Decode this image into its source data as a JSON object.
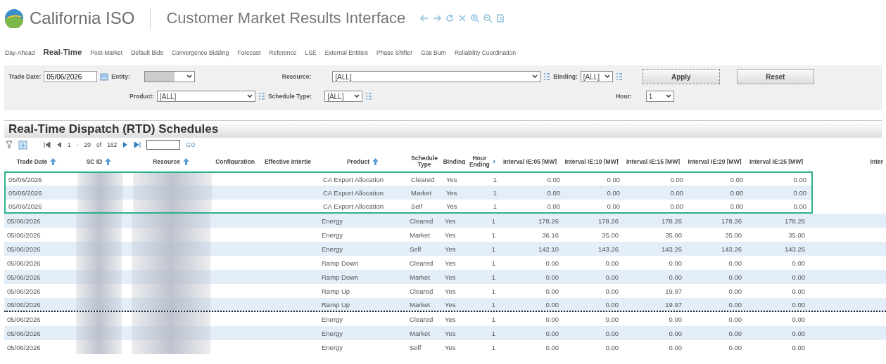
{
  "header": {
    "brand": "California ISO",
    "title": "Customer Market Results Interface"
  },
  "nav": [
    {
      "label": "Day-Ahead",
      "selected": false
    },
    {
      "label": "Real-Time",
      "selected": true
    },
    {
      "label": "Post-Market",
      "selected": false
    },
    {
      "label": "Default Bids",
      "selected": false
    },
    {
      "label": "Convergence Bidding",
      "selected": false
    },
    {
      "label": "Forecast",
      "selected": false
    },
    {
      "label": "Reference",
      "selected": false
    },
    {
      "label": "LSE",
      "selected": false
    },
    {
      "label": "External Entities",
      "selected": false
    },
    {
      "label": "Phase Shifter",
      "selected": false
    },
    {
      "label": "Gas Burn",
      "selected": false
    },
    {
      "label": "Reliability Coordination",
      "selected": false
    }
  ],
  "filters": {
    "trade_date": {
      "label": "Trade Date:",
      "value": "05/06/2026"
    },
    "entity": {
      "label": "Entity:"
    },
    "resource": {
      "label": "Resource:",
      "value": "[ALL]"
    },
    "binding": {
      "label": "Binding:",
      "value": "[ALL]"
    },
    "product": {
      "label": "Product:",
      "value": "[ALL]"
    },
    "schedule_type": {
      "label": "Schedule Type:",
      "value": "[ALL]"
    },
    "hour": {
      "label": "Hour:",
      "value": "1"
    },
    "buttons": [
      "Apply",
      "Reset"
    ]
  },
  "section_title": "Real-Time Dispatch (RTD) Schedules",
  "pager": {
    "from": "1",
    "dash": "-",
    "to": "20",
    "of": "of",
    "total": "162",
    "go": "GO"
  },
  "table": {
    "columns": [
      {
        "label": "Trade Date",
        "sortable": true
      },
      {
        "label": "SC ID",
        "sortable": true
      },
      {
        "label": "Resource",
        "sortable": true
      },
      {
        "label": "Configuration",
        "sortable": false
      },
      {
        "label": "Effective Intertie",
        "sortable": false
      },
      {
        "label": "Product",
        "sortable": true
      },
      {
        "label": "Schedule Type",
        "sortable": false
      },
      {
        "label": "Binding",
        "sortable": false
      },
      {
        "label": "Hour Ending",
        "sortable": true
      },
      {
        "label": "Interval IE:05 [MW]",
        "sortable": false
      },
      {
        "label": "Interval IE:10 [MW]",
        "sortable": false
      },
      {
        "label": "Interval IE:15 [MW]",
        "sortable": false
      },
      {
        "label": "Interval IE:20 [MW]",
        "sortable": false
      },
      {
        "label": "Interval IE:25 [MW]",
        "sortable": false
      },
      {
        "label": "Inter",
        "sortable": false
      }
    ],
    "rows": [
      {
        "trade_date": "05/06/2026",
        "product": "CA Export Allocation",
        "schedule_type": "Cleared",
        "binding": "Yes",
        "hour": "1",
        "intervals": [
          "0.00",
          "0.00",
          "0.00",
          "0.00",
          "0.00"
        ],
        "highlighted": true,
        "dotted_divider_below": false
      },
      {
        "trade_date": "05/06/2026",
        "product": "CA Export Allocation",
        "schedule_type": "Market",
        "binding": "Yes",
        "hour": "1",
        "intervals": [
          "0.00",
          "0.00",
          "0.00",
          "0.00",
          "0.00"
        ],
        "highlighted": true,
        "dotted_divider_below": false
      },
      {
        "trade_date": "05/06/2026",
        "product": "CA Export Allocation",
        "schedule_type": "Self",
        "binding": "Yes",
        "hour": "1",
        "intervals": [
          "0.00",
          "0.00",
          "0.00",
          "0.00",
          "0.00"
        ],
        "highlighted": true,
        "dotted_divider_below": false
      },
      {
        "trade_date": "05/06/2026",
        "product": "Energy",
        "schedule_type": "Cleared",
        "binding": "Yes",
        "hour": "1",
        "intervals": [
          "178.26",
          "178.26",
          "178.26",
          "178.26",
          "178.26"
        ],
        "highlighted": false,
        "dotted_divider_below": false
      },
      {
        "trade_date": "05/06/2026",
        "product": "Energy",
        "schedule_type": "Market",
        "binding": "Yes",
        "hour": "1",
        "intervals": [
          "36.16",
          "35.00",
          "35.00",
          "35.00",
          "35.00"
        ],
        "highlighted": false,
        "dotted_divider_below": false
      },
      {
        "trade_date": "05/06/2026",
        "product": "Energy",
        "schedule_type": "Self",
        "binding": "Yes",
        "hour": "1",
        "intervals": [
          "142.10",
          "143.26",
          "143.26",
          "143.26",
          "143.26"
        ],
        "highlighted": false,
        "dotted_divider_below": false
      },
      {
        "trade_date": "05/06/2026",
        "product": "Ramp Down",
        "schedule_type": "Cleared",
        "binding": "Yes",
        "hour": "1",
        "intervals": [
          "0.00",
          "0.00",
          "0.00",
          "0.00",
          "0.00"
        ],
        "highlighted": false,
        "dotted_divider_below": false
      },
      {
        "trade_date": "05/06/2026",
        "product": "Ramp Down",
        "schedule_type": "Market",
        "binding": "Yes",
        "hour": "1",
        "intervals": [
          "0.00",
          "0.00",
          "0.00",
          "0.00",
          "0.00"
        ],
        "highlighted": false,
        "dotted_divider_below": false
      },
      {
        "trade_date": "05/06/2026",
        "product": "Ramp Up",
        "schedule_type": "Cleared",
        "binding": "Yes",
        "hour": "1",
        "intervals": [
          "0.00",
          "0.00",
          "19.97",
          "0.00",
          "0.00"
        ],
        "highlighted": false,
        "dotted_divider_below": false
      },
      {
        "trade_date": "05/06/2026",
        "product": "Ramp Up",
        "schedule_type": "Market",
        "binding": "Yes",
        "hour": "1",
        "intervals": [
          "0.00",
          "0.00",
          "19.97",
          "0.00",
          "0.00"
        ],
        "highlighted": false,
        "dotted_divider_below": true
      },
      {
        "trade_date": "05/06/2026",
        "product": "Energy",
        "schedule_type": "Cleared",
        "binding": "Yes",
        "hour": "1",
        "intervals": [
          "0.00",
          "0.00",
          "0.00",
          "0.00",
          "0.00"
        ],
        "highlighted": false,
        "dotted_divider_below": false
      },
      {
        "trade_date": "05/06/2026",
        "product": "Energy",
        "schedule_type": "Market",
        "binding": "Yes",
        "hour": "1",
        "intervals": [
          "0.00",
          "0.00",
          "0.00",
          "0.00",
          "0.00"
        ],
        "highlighted": false,
        "dotted_divider_below": false
      },
      {
        "trade_date": "05/06/2026",
        "product": "Energy",
        "schedule_type": "Self",
        "binding": "Yes",
        "hour": "1",
        "intervals": [
          "0.00",
          "0.00",
          "0.00",
          "0.00",
          "0.00"
        ],
        "highlighted": false,
        "dotted_divider_below": false
      }
    ]
  }
}
